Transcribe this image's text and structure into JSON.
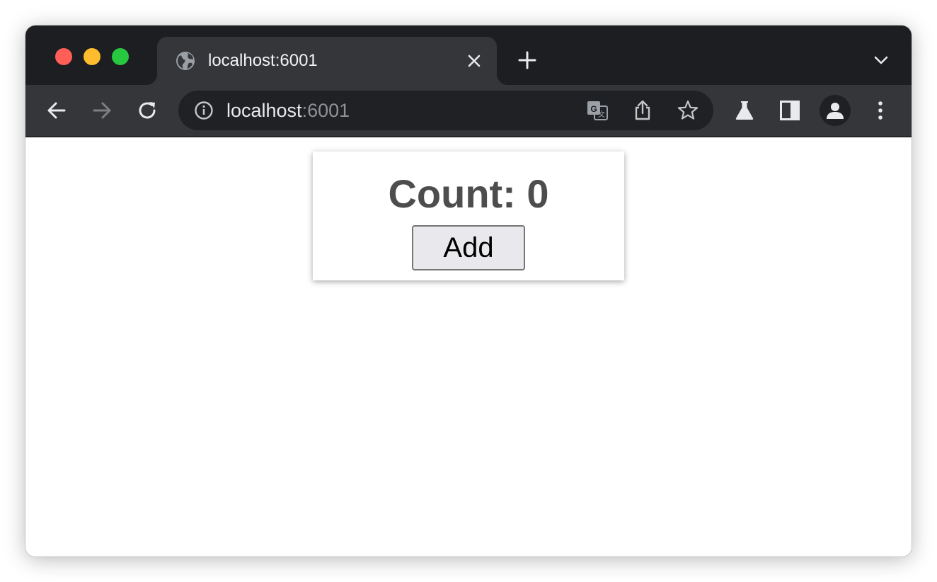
{
  "window": {
    "traffic_lights": [
      "close",
      "minimize",
      "zoom"
    ],
    "colors": {
      "close": "#ff5f57",
      "minimize": "#febc2e",
      "zoom": "#28c840"
    }
  },
  "tabs": [
    {
      "title": "localhost:6001",
      "favicon": "globe-icon",
      "active": true
    }
  ],
  "toolbar": {
    "back_icon": "back-arrow-icon",
    "forward_icon": "forward-arrow-icon",
    "reload_icon": "reload-icon",
    "right_icons": [
      "labs-flask-icon",
      "side-panel-icon",
      "profile-avatar-icon",
      "more-menu-icon"
    ]
  },
  "omnibox": {
    "host": "localhost",
    "port": ":6001",
    "icons": [
      "site-info-icon",
      "translate-icon",
      "share-icon",
      "bookmark-star-icon"
    ]
  },
  "page": {
    "count_text": "Count: 0",
    "add_button_label": "Add"
  }
}
